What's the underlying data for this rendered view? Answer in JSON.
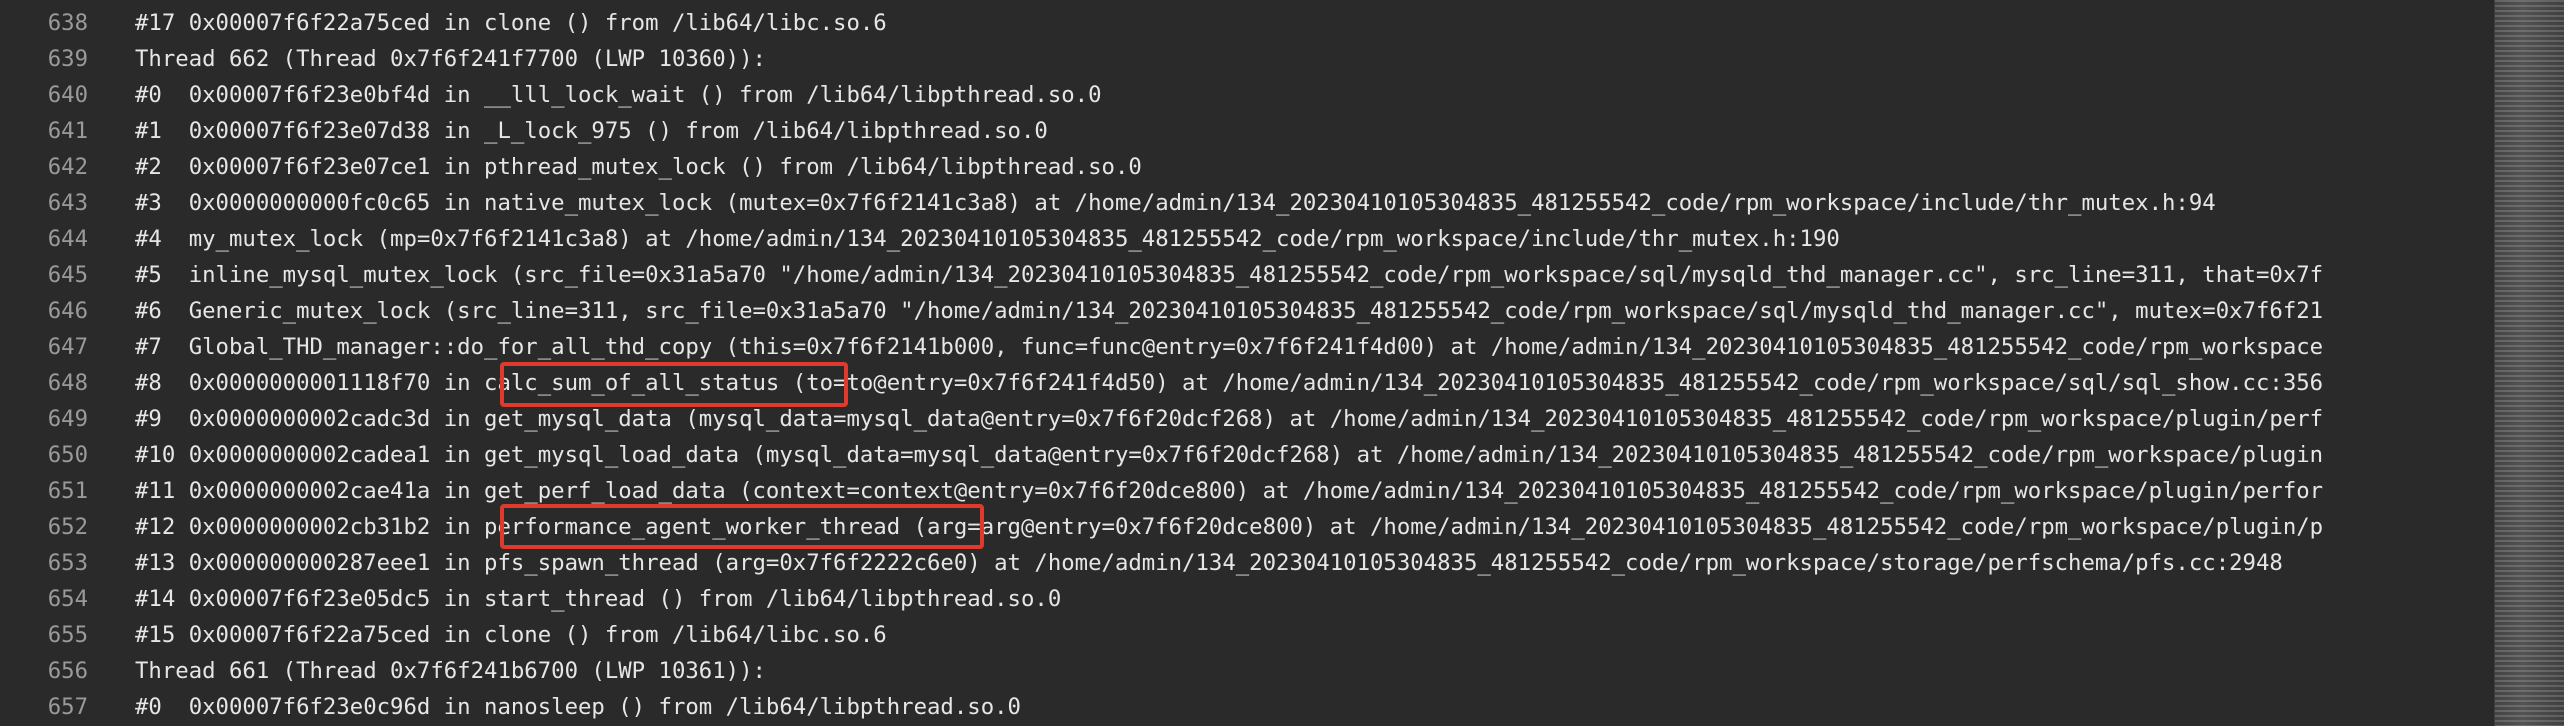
{
  "editor": {
    "lines": [
      {
        "num": "638",
        "text": "#17 0x00007f6f22a75ced in clone () from /lib64/libc.so.6"
      },
      {
        "num": "639",
        "text": "Thread 662 (Thread 0x7f6f241f7700 (LWP 10360)):"
      },
      {
        "num": "640",
        "text": "#0  0x00007f6f23e0bf4d in __lll_lock_wait () from /lib64/libpthread.so.0"
      },
      {
        "num": "641",
        "text": "#1  0x00007f6f23e07d38 in _L_lock_975 () from /lib64/libpthread.so.0"
      },
      {
        "num": "642",
        "text": "#2  0x00007f6f23e07ce1 in pthread_mutex_lock () from /lib64/libpthread.so.0"
      },
      {
        "num": "643",
        "text": "#3  0x0000000000fc0c65 in native_mutex_lock (mutex=0x7f6f2141c3a8) at /home/admin/134_20230410105304835_481255542_code/rpm_workspace/include/thr_mutex.h:94"
      },
      {
        "num": "644",
        "text": "#4  my_mutex_lock (mp=0x7f6f2141c3a8) at /home/admin/134_20230410105304835_481255542_code/rpm_workspace/include/thr_mutex.h:190"
      },
      {
        "num": "645",
        "text": "#5  inline_mysql_mutex_lock (src_file=0x31a5a70 \"/home/admin/134_20230410105304835_481255542_code/rpm_workspace/sql/mysqld_thd_manager.cc\", src_line=311, that=0x7f"
      },
      {
        "num": "646",
        "text": "#6  Generic_mutex_lock (src_line=311, src_file=0x31a5a70 \"/home/admin/134_20230410105304835_481255542_code/rpm_workspace/sql/mysqld_thd_manager.cc\", mutex=0x7f6f21"
      },
      {
        "num": "647",
        "text": "#7  Global_THD_manager::do_for_all_thd_copy (this=0x7f6f2141b000, func=func@entry=0x7f6f241f4d00) at /home/admin/134_20230410105304835_481255542_code/rpm_workspace"
      },
      {
        "num": "648",
        "text": "#8  0x0000000001118f70 in calc_sum_of_all_status (to=to@entry=0x7f6f241f4d50) at /home/admin/134_20230410105304835_481255542_code/rpm_workspace/sql/sql_show.cc:356"
      },
      {
        "num": "649",
        "text": "#9  0x0000000002cadc3d in get_mysql_data (mysql_data=mysql_data@entry=0x7f6f20dcf268) at /home/admin/134_20230410105304835_481255542_code/rpm_workspace/plugin/perf"
      },
      {
        "num": "650",
        "text": "#10 0x0000000002cadea1 in get_mysql_load_data (mysql_data=mysql_data@entry=0x7f6f20dcf268) at /home/admin/134_20230410105304835_481255542_code/rpm_workspace/plugin"
      },
      {
        "num": "651",
        "text": "#11 0x0000000002cae41a in get_perf_load_data (context=context@entry=0x7f6f20dce800) at /home/admin/134_20230410105304835_481255542_code/rpm_workspace/plugin/perfor"
      },
      {
        "num": "652",
        "text": "#12 0x0000000002cb31b2 in performance_agent_worker_thread (arg=arg@entry=0x7f6f20dce800) at /home/admin/134_20230410105304835_481255542_code/rpm_workspace/plugin/p"
      },
      {
        "num": "653",
        "text": "#13 0x000000000287eee1 in pfs_spawn_thread (arg=0x7f6f2222c6e0) at /home/admin/134_20230410105304835_481255542_code/rpm_workspace/storage/perfschema/pfs.cc:2948"
      },
      {
        "num": "654",
        "text": "#14 0x00007f6f23e05dc5 in start_thread () from /lib64/libpthread.so.0"
      },
      {
        "num": "655",
        "text": "#15 0x00007f6f22a75ced in clone () from /lib64/libc.so.6"
      },
      {
        "num": "656",
        "text": "Thread 661 (Thread 0x7f6f241b6700 (LWP 10361)):"
      },
      {
        "num": "657",
        "text": "#0  0x00007f6f23e0c96d in nanosleep () from /lib64/libpthread.so.0"
      }
    ],
    "highlight_color": "#e0392d"
  }
}
